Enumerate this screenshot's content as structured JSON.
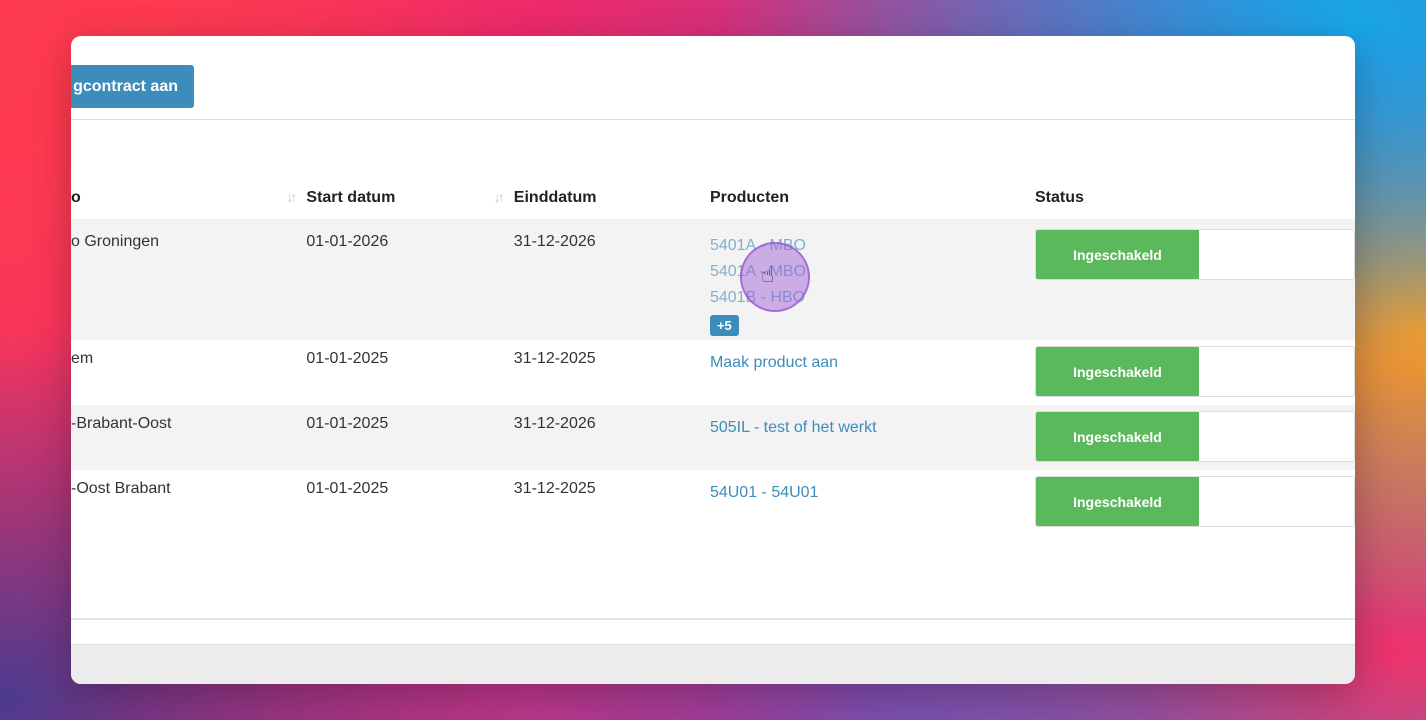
{
  "toolbar": {
    "create_label": "gcontract aan"
  },
  "table": {
    "columns": [
      {
        "label": "o"
      },
      {
        "label": "Start datum"
      },
      {
        "label": "Einddatum"
      },
      {
        "label": "Producten"
      },
      {
        "label": "Status"
      }
    ],
    "rows": [
      {
        "name": "o Groningen",
        "start": "01-01-2026",
        "end": "31-12-2026",
        "products": [
          "5401A - MBO",
          "5401A - MBO",
          "5401B - HBO"
        ],
        "more_badge": "+5",
        "status": "Ingeschakeld"
      },
      {
        "name": "em",
        "start": "01-01-2025",
        "end": "31-12-2025",
        "products": [
          "Maak product aan"
        ],
        "status": "Ingeschakeld"
      },
      {
        "name": "-Brabant-Oost",
        "start": "01-01-2025",
        "end": "31-12-2026",
        "products": [
          "505IL - test of het werkt"
        ],
        "status": "Ingeschakeld"
      },
      {
        "name": "-Oost Brabant",
        "start": "01-01-2025",
        "end": "31-12-2025",
        "products": [
          "54U01 - 54U01"
        ],
        "status": "Ingeschakeld"
      }
    ]
  },
  "colors": {
    "primary": "#3c8dbc",
    "success": "#5cb85c",
    "row_alt": "#f3f3f3"
  },
  "icons": {
    "sort": "sort-arrows-icon",
    "cursor": "hand-pointer-icon"
  }
}
